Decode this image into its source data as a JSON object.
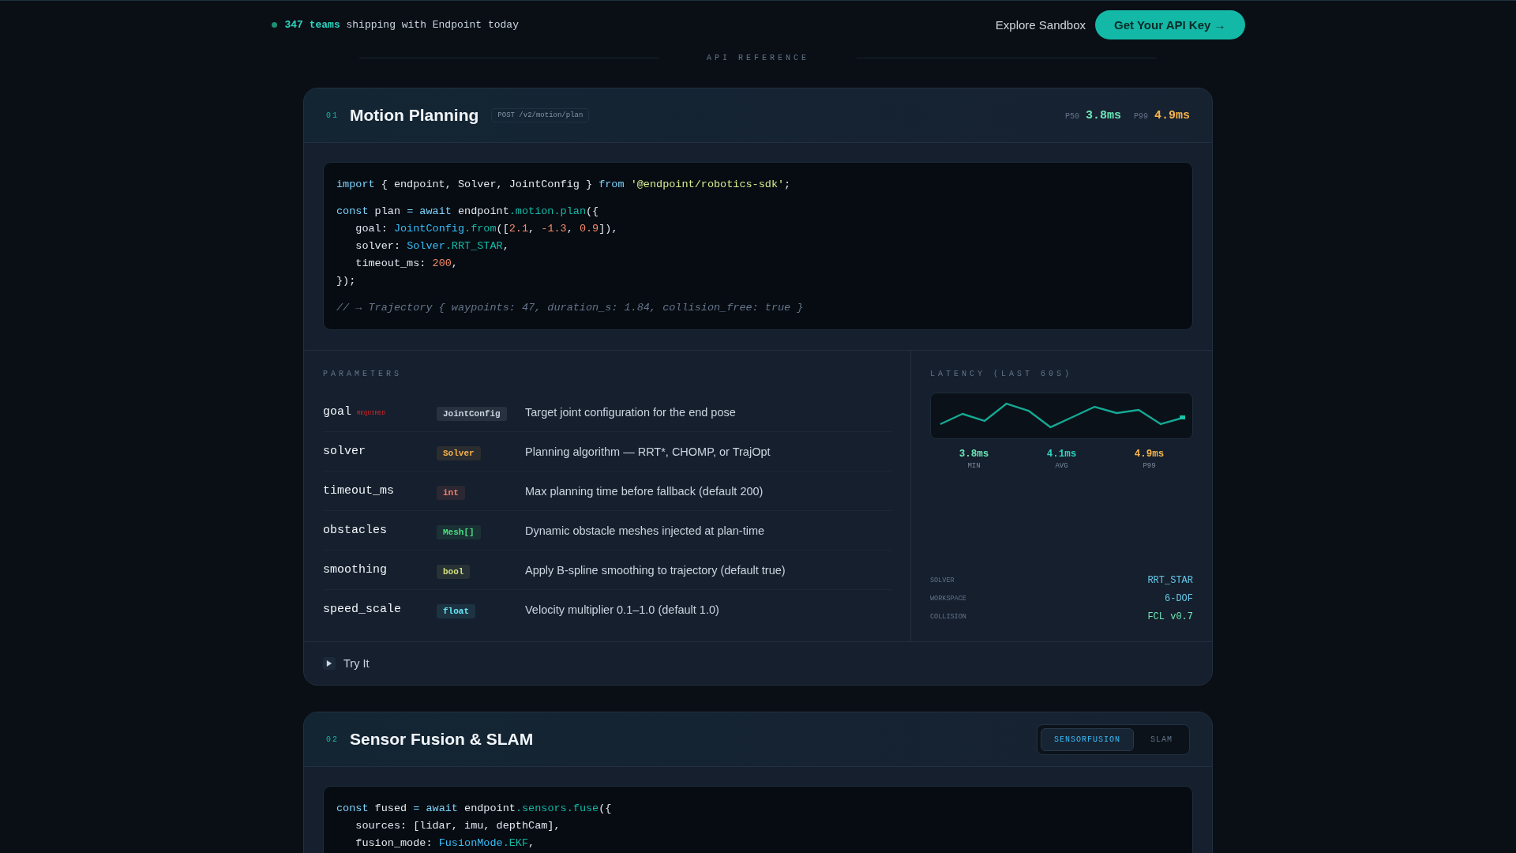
{
  "banner": {
    "count": "347 teams",
    "text": "shipping with Endpoint today"
  },
  "nav": {
    "link": "Explore Sandbox",
    "cta": "Get Your API Key →"
  },
  "section_label": "API REFERENCE",
  "endpoints": [
    {
      "number": "01",
      "title": "Motion Planning",
      "route": "POST /v2/motion/plan",
      "metrics": [
        {
          "label": "P50",
          "value": "3.8ms",
          "color": "#6ee7b7"
        },
        {
          "label": "P99",
          "value": "4.9ms",
          "color": "#f6b44b"
        }
      ],
      "code": [
        [
          [
            {
              "kind": "keyword",
              "text": "import"
            },
            {
              "kind": "plain",
              "text": " { endpoint, Solver, JointConfig } "
            },
            {
              "kind": "keyword",
              "text": "from"
            },
            {
              "kind": "string",
              "text": " '@endpoint/robotics-sdk'"
            },
            {
              "kind": "plain",
              "text": ";"
            }
          ]
        ],
        [
          [
            {
              "kind": "keyword",
              "text": "const"
            },
            {
              "kind": "plain",
              "text": " plan "
            },
            {
              "kind": "keyword",
              "text": "= await"
            },
            {
              "kind": "plain",
              "text": " endpoint"
            },
            {
              "kind": "method",
              "text": ".motion.plan"
            },
            {
              "kind": "plain",
              "text": "({"
            }
          ],
          [
            {
              "kind": "plain",
              "text": "   goal: "
            },
            {
              "kind": "type",
              "text": "JointConfig"
            },
            {
              "kind": "method",
              "text": ".from"
            },
            {
              "kind": "plain",
              "text": "(["
            },
            {
              "kind": "number",
              "text": "2.1"
            },
            {
              "kind": "plain",
              "text": ", "
            },
            {
              "kind": "number",
              "text": "-1.3"
            },
            {
              "kind": "plain",
              "text": ", "
            },
            {
              "kind": "number",
              "text": "0.9"
            },
            {
              "kind": "plain",
              "text": "]),"
            }
          ],
          [
            {
              "kind": "plain",
              "text": "   solver: "
            },
            {
              "kind": "type",
              "text": "Solver"
            },
            {
              "kind": "method",
              "text": ".RRT_STAR"
            },
            {
              "kind": "plain",
              "text": ","
            }
          ],
          [
            {
              "kind": "plain",
              "text": "   timeout_ms: "
            },
            {
              "kind": "number",
              "text": "200"
            },
            {
              "kind": "plain",
              "text": ","
            }
          ],
          [
            {
              "kind": "plain",
              "text": "});"
            }
          ]
        ],
        [
          [
            {
              "kind": "comment",
              "text": "// → Trajectory { waypoints: 47, duration_s: 1.84, collision_free: true }"
            }
          ]
        ]
      ],
      "parameters": {
        "heading": "PARAMETERS",
        "rows": [
          {
            "name": "goal",
            "badge": "REQUIRED",
            "type": "JointConfig",
            "color": "#cbd5e1",
            "description": "Target joint configuration for the end pose"
          },
          {
            "name": "solver",
            "type": "Solver",
            "color": "#f6b44b",
            "description": "Planning algorithm — RRT*, CHOMP, or TrajOpt"
          },
          {
            "name": "timeout_ms",
            "type": "int",
            "color": "#f87f6c",
            "description": "Max planning time before fallback (default 200)"
          },
          {
            "name": "obstacles",
            "type": "Mesh[]",
            "color": "#4ade80",
            "description": "Dynamic obstacle meshes injected at plan-time"
          },
          {
            "name": "smoothing",
            "type": "bool",
            "color": "#d4e07c",
            "description": "Apply B-spline smoothing to trajectory (default true)"
          },
          {
            "name": "speed_scale",
            "type": "float",
            "color": "#67e8f9",
            "description": "Velocity multiplier 0.1–1.0 (default 1.0)"
          }
        ]
      },
      "latency": {
        "heading": "LATENCY (LAST 60S)",
        "stats": [
          {
            "value": "3.8ms",
            "label": "MIN",
            "color": "#6ee7b7"
          },
          {
            "value": "4.1ms",
            "label": "AVG",
            "color": "#2dd4bf"
          },
          {
            "value": "4.9ms",
            "label": "P99",
            "color": "#f6b44b"
          }
        ],
        "info": [
          {
            "label": "SOLVER",
            "value": "RRT_STAR",
            "color": "#67c6e8"
          },
          {
            "label": "WORKSPACE",
            "value": "6-DOF",
            "color": "#67c6e8"
          },
          {
            "label": "COLLISION",
            "value": "FCL v0.7",
            "color": "#6ee7b7"
          }
        ]
      },
      "try_it": "Try It"
    },
    {
      "number": "02",
      "title": "Sensor Fusion & SLAM",
      "tabs": [
        {
          "label": "SENSORFUSION",
          "selected": true
        },
        {
          "label": "SLAM",
          "selected": false
        }
      ],
      "code": [
        [
          [
            {
              "kind": "keyword",
              "text": "const"
            },
            {
              "kind": "plain",
              "text": " fused "
            },
            {
              "kind": "keyword",
              "text": "= await"
            },
            {
              "kind": "plain",
              "text": " endpoint"
            },
            {
              "kind": "method",
              "text": ".sensors.fuse"
            },
            {
              "kind": "plain",
              "text": "({"
            }
          ],
          [
            {
              "kind": "plain",
              "text": "   sources: [lidar, imu, depthCam],"
            }
          ],
          [
            {
              "kind": "plain",
              "text": "   fusion_mode: "
            },
            {
              "kind": "type",
              "text": "FusionMode"
            },
            {
              "kind": "method",
              "text": ".EKF"
            },
            {
              "kind": "plain",
              "text": ","
            }
          ]
        ]
      ]
    }
  ]
}
